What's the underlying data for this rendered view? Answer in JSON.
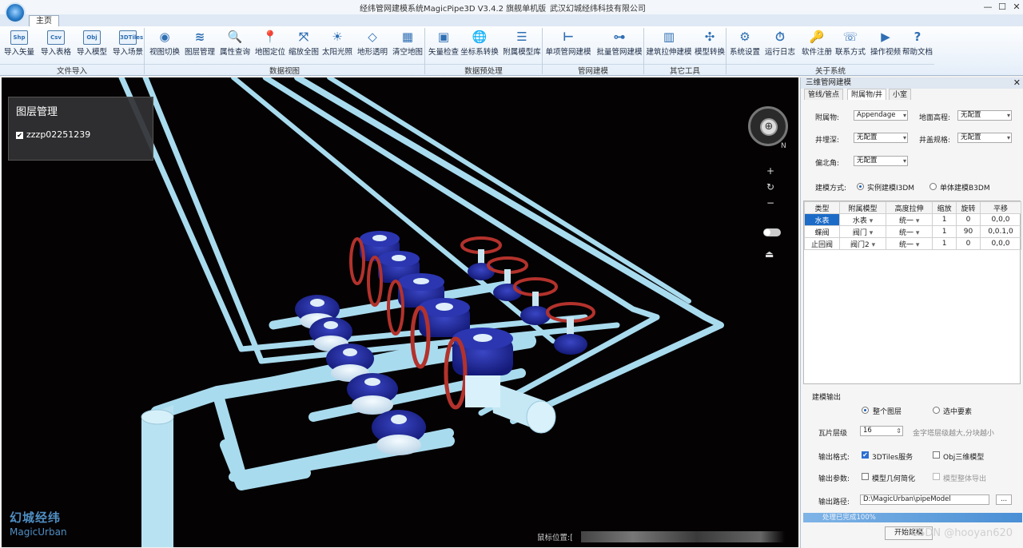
{
  "window": {
    "title": "经纬管网建模系统MagicPipe3D  V3.4.2  旗舰单机版",
    "company": "武汉幻城经纬科技有限公司",
    "minimize": "—",
    "maximize": "☐",
    "close": "✕"
  },
  "ribbon": {
    "tab": "主页",
    "buttons": [
      {
        "label": "导入矢量",
        "glyph": "Shp"
      },
      {
        "label": "导入表格",
        "glyph": "Csv"
      },
      {
        "label": "导入模型",
        "glyph": "Obj"
      },
      {
        "label": "导入场景",
        "glyph": "3DTiles"
      },
      {
        "label": "视图切换",
        "glyph": "◉"
      },
      {
        "label": "图层管理",
        "glyph": "≋"
      },
      {
        "label": "属性查询",
        "glyph": "🔍"
      },
      {
        "label": "地图定位",
        "glyph": "📍"
      },
      {
        "label": "缩放全图",
        "glyph": "⤧"
      },
      {
        "label": "太阳光照",
        "glyph": "☀"
      },
      {
        "label": "地形透明",
        "glyph": "◇"
      },
      {
        "label": "清空地图",
        "glyph": "▦"
      },
      {
        "label": "矢量检查",
        "glyph": "▣"
      },
      {
        "label": "坐标系转换",
        "glyph": "🌐"
      },
      {
        "label": "附属模型库",
        "glyph": "☰"
      },
      {
        "label": "单项管网建模",
        "glyph": "⊢"
      },
      {
        "label": "批量管网建模",
        "glyph": "⊶"
      },
      {
        "label": "建筑拉伸建模",
        "glyph": "▥"
      },
      {
        "label": "模型转换",
        "glyph": "✣"
      },
      {
        "label": "系统设置",
        "glyph": "⚙"
      },
      {
        "label": "运行日志",
        "glyph": "⏱"
      },
      {
        "label": "软件注册",
        "glyph": "🔑"
      },
      {
        "label": "联系方式",
        "glyph": "☏"
      },
      {
        "label": "操作视频",
        "glyph": "▶"
      },
      {
        "label": "帮助文档",
        "glyph": "?"
      }
    ],
    "groups": [
      "文件导入",
      "数据视图",
      "数据预处理",
      "管网建模",
      "其它工具",
      "关于系统"
    ]
  },
  "viewport": {
    "layer_panel": {
      "title": "图层管理",
      "layer": "zzzp02251239",
      "checked": "✔"
    },
    "compass": {
      "north": "N",
      "center": "⊕"
    },
    "zoom_in": "+",
    "reset": "↻",
    "zoom_out": "−",
    "erase": "⏏",
    "brand_cn": "幻城经纬",
    "brand_en": "MagicUrban",
    "coord_label": "鼠标位置:["
  },
  "panel": {
    "title": "三维管网建模",
    "tabs": [
      "管线/管点",
      "附属物/井",
      "小室"
    ],
    "fields": {
      "attachment_label": "附属物:",
      "attachment_value": "Appendage",
      "ground_label": "地面高程:",
      "ground_value": "无配置",
      "well_depth_label": "井埋深:",
      "well_depth_value": "无配置",
      "cover_label": "井盖规格:",
      "cover_value": "无配置",
      "north_label": "偏北角:",
      "north_value": "无配置",
      "mode_label": "建模方式:",
      "mode_instance": "实例建模I3DM",
      "mode_single": "单体建模B3DM"
    },
    "table": {
      "headers": [
        "类型",
        "附属模型",
        "高度拉伸",
        "缩放",
        "旋转",
        "平移"
      ],
      "rows": [
        [
          "水表",
          "水表",
          "统一",
          "1",
          "0",
          "0,0,0"
        ],
        [
          "蝶阀",
          "阀门",
          "统一",
          "1",
          "90",
          "0,0.1,0"
        ],
        [
          "止回阀",
          "阀门2",
          "统一",
          "1",
          "0",
          "0,0,0"
        ]
      ]
    },
    "output": {
      "section": "建模输出",
      "all_layers": "整个图层",
      "selected": "选中要素",
      "tile_label": "瓦片层级",
      "tile_value": "16",
      "tile_hint": "金字塔层级越大,分块越小",
      "format_label": "输出格式:",
      "fmt_3dtiles": "3DTiles服务",
      "fmt_obj": "Obj三维模型",
      "param_label": "输出参数:",
      "simplify": "模型几何简化",
      "whole_export": "模型整体导出",
      "path_label": "输出路径:",
      "path_value": "D:\\MagicUrban\\pipeModel",
      "browse": "...",
      "progress": "处理已完成100%",
      "start": "开始建模"
    }
  },
  "watermark": "CSDN @hooyan620"
}
